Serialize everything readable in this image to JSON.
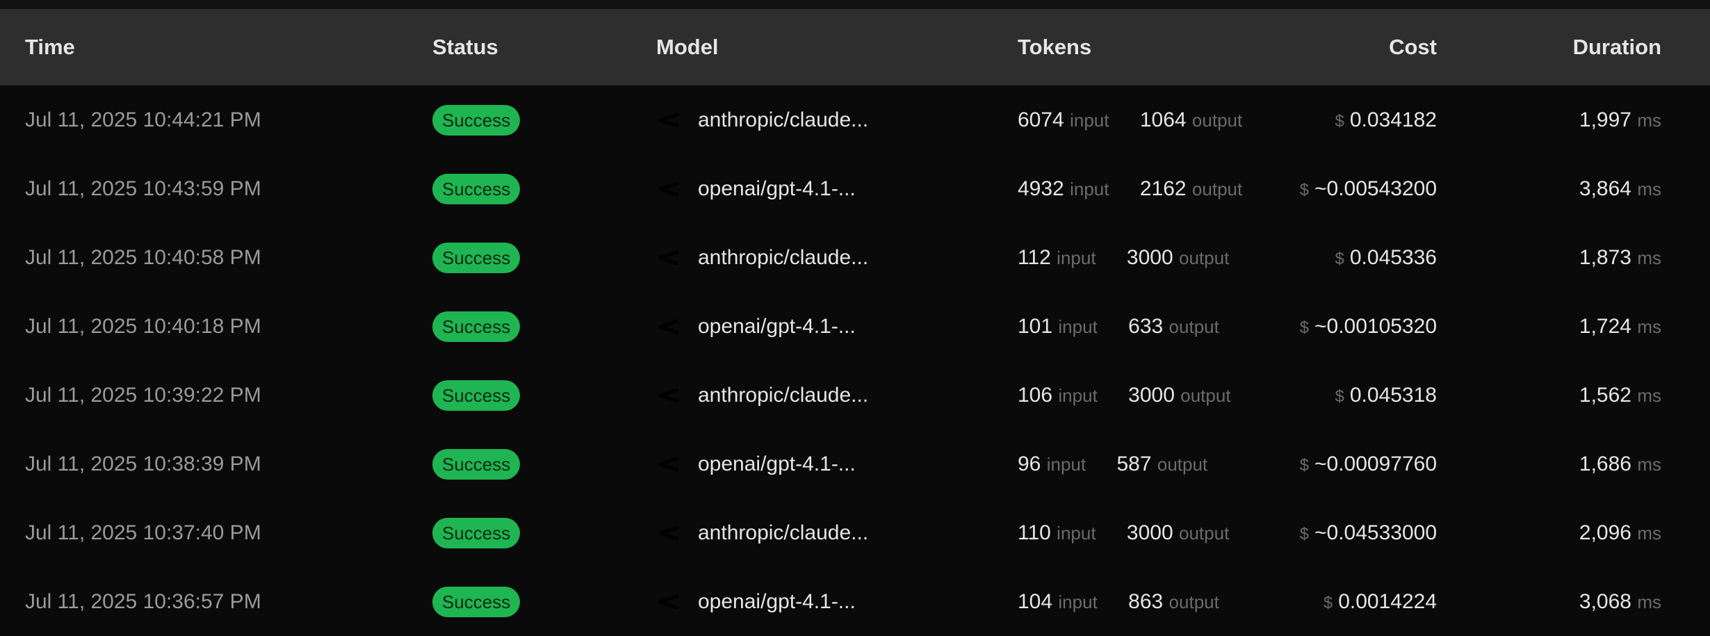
{
  "headers": {
    "time": "Time",
    "status": "Status",
    "model": "Model",
    "tokens": "Tokens",
    "cost": "Cost",
    "duration": "Duration"
  },
  "units": {
    "input": "input",
    "output": "output",
    "currency": "$",
    "ms": "ms"
  },
  "colors": {
    "success_badge": "#1fb552",
    "header_bg": "#2e2e2e",
    "page_bg": "#0a0a0a"
  },
  "rows": [
    {
      "time": "Jul 11, 2025 10:44:21 PM",
      "status": "Success",
      "model": "anthropic/claude...",
      "input": "6074",
      "output": "1064",
      "cost": "0.034182",
      "duration": "1,997"
    },
    {
      "time": "Jul 11, 2025 10:43:59 PM",
      "status": "Success",
      "model": "openai/gpt-4.1-...",
      "input": "4932",
      "output": "2162",
      "cost": "~0.00543200",
      "duration": "3,864"
    },
    {
      "time": "Jul 11, 2025 10:40:58 PM",
      "status": "Success",
      "model": "anthropic/claude...",
      "input": "112",
      "output": "3000",
      "cost": "0.045336",
      "duration": "1,873"
    },
    {
      "time": "Jul 11, 2025 10:40:18 PM",
      "status": "Success",
      "model": "openai/gpt-4.1-...",
      "input": "101",
      "output": "633",
      "cost": "~0.00105320",
      "duration": "1,724"
    },
    {
      "time": "Jul 11, 2025 10:39:22 PM",
      "status": "Success",
      "model": "anthropic/claude...",
      "input": "106",
      "output": "3000",
      "cost": "0.045318",
      "duration": "1,562"
    },
    {
      "time": "Jul 11, 2025 10:38:39 PM",
      "status": "Success",
      "model": "openai/gpt-4.1-...",
      "input": "96",
      "output": "587",
      "cost": "~0.00097760",
      "duration": "1,686"
    },
    {
      "time": "Jul 11, 2025 10:37:40 PM",
      "status": "Success",
      "model": "anthropic/claude...",
      "input": "110",
      "output": "3000",
      "cost": "~0.04533000",
      "duration": "2,096"
    },
    {
      "time": "Jul 11, 2025 10:36:57 PM",
      "status": "Success",
      "model": "openai/gpt-4.1-...",
      "input": "104",
      "output": "863",
      "cost": "0.0014224",
      "duration": "3,068"
    }
  ]
}
